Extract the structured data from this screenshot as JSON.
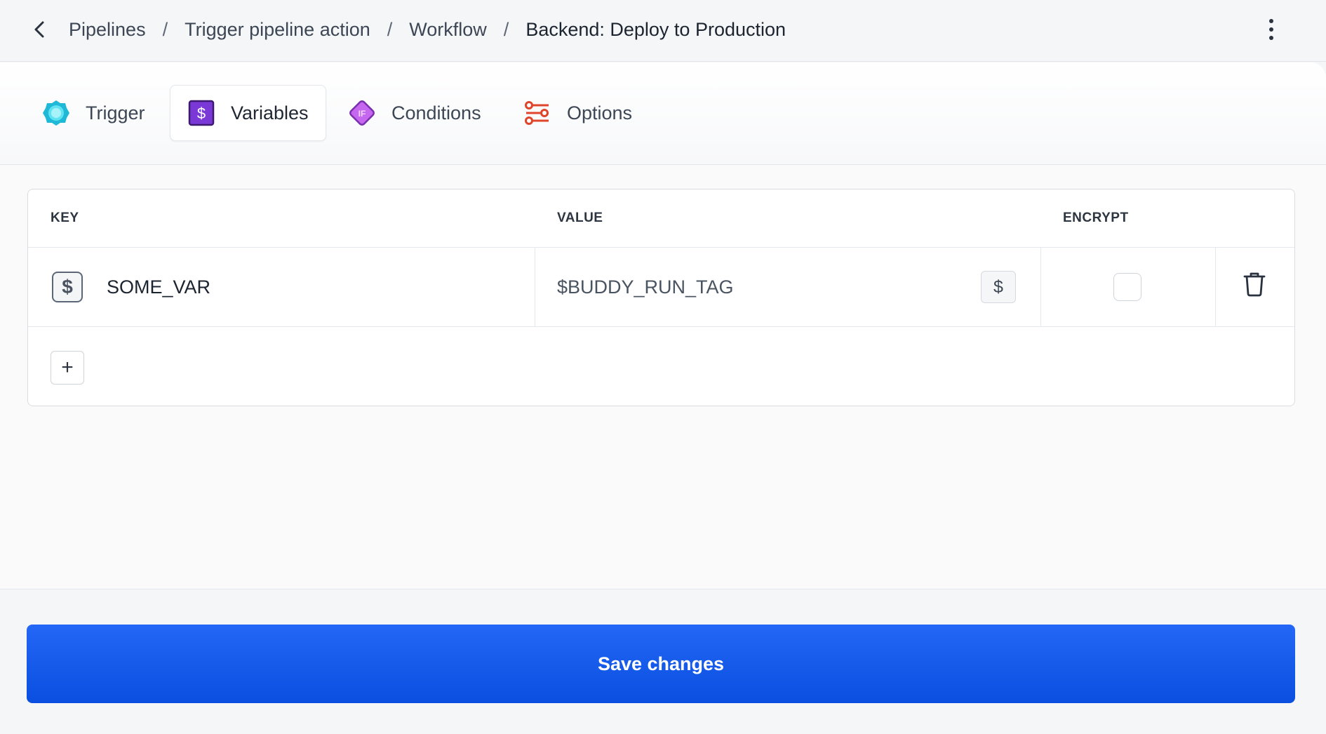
{
  "breadcrumb": {
    "items": [
      "Pipelines",
      "Trigger pipeline action",
      "Workflow"
    ],
    "current": "Backend: Deploy to Production",
    "separator": "/"
  },
  "tabs": [
    {
      "label": "Trigger",
      "icon": "trigger-icon",
      "active": false
    },
    {
      "label": "Variables",
      "icon": "variable-icon",
      "active": true
    },
    {
      "label": "Conditions",
      "icon": "conditions-icon",
      "active": false
    },
    {
      "label": "Options",
      "icon": "options-icon",
      "active": false
    }
  ],
  "variables_table": {
    "columns": {
      "key": "KEY",
      "value": "VALUE",
      "encrypt": "ENCRYPT"
    },
    "rows": [
      {
        "key": "SOME_VAR",
        "value": "$BUDDY_RUN_TAG",
        "encrypt": false
      }
    ],
    "picker_symbol": "$",
    "key_icon_symbol": "$",
    "add_symbol": "+"
  },
  "footer": {
    "save_label": "Save changes"
  },
  "colors": {
    "primary": "#1a5cf0",
    "variables_tab": "#6d2fc4",
    "conditions_tab": "#b24de6",
    "trigger_tab": "#22c6e0",
    "options_tab": "#e0442b"
  }
}
